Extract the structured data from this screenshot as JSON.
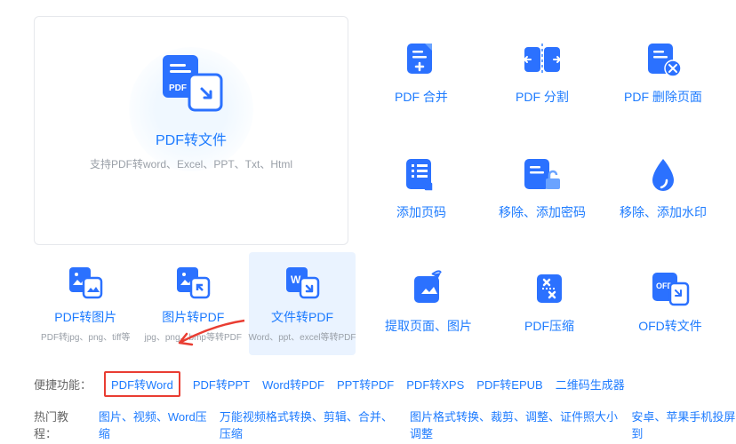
{
  "mainCard": {
    "title": "PDF转文件",
    "subtitle": "支持PDF转word、Excel、PPT、Txt、Html"
  },
  "rightGrid": [
    {
      "label": "PDF 合并"
    },
    {
      "label": "PDF 分割"
    },
    {
      "label": "PDF 删除页面"
    },
    {
      "label": "添加页码"
    },
    {
      "label": "移除、添加密码"
    },
    {
      "label": "移除、添加水印"
    }
  ],
  "bottomLeft": [
    {
      "title": "PDF转图片",
      "sub": "PDF转jpg、png、tiff等"
    },
    {
      "title": "图片转PDF",
      "sub": "jpg、png、bmp等转PDF"
    },
    {
      "title": "文件转PDF",
      "sub": "Word、ppt、excel等转PDF"
    }
  ],
  "bottomRight": [
    {
      "label": "提取页面、图片"
    },
    {
      "label": "PDF压缩"
    },
    {
      "label": "OFD转文件"
    }
  ],
  "quickLinks": {
    "label": "便捷功能：",
    "items": [
      "PDF转Word",
      "PDF转PPT",
      "Word转PDF",
      "PPT转PDF",
      "PDF转XPS",
      "PDF转EPUB",
      "二维码生成器"
    ]
  },
  "hotTutorials": {
    "label": "热门教程：",
    "items": [
      "图片、视频、Word压缩",
      "万能视频格式转换、剪辑、合并、压缩",
      "图片格式转换、裁剪、调整、证件照大小调整",
      "安卓、苹果手机投屏到"
    ]
  }
}
